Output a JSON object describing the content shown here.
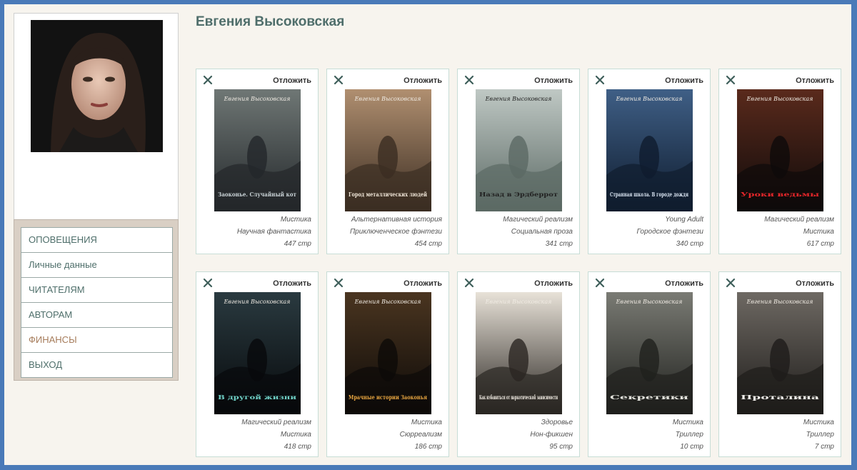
{
  "author_name": "Евгения Высоковская",
  "menu": [
    {
      "label": "ОПОВЕЩЕНИЯ"
    },
    {
      "label": "Личные данные"
    },
    {
      "label": "ЧИТАТЕЛЯМ"
    },
    {
      "label": "АВТОРАМ"
    },
    {
      "label": "ФИНАНСЫ"
    },
    {
      "label": "ВЫХОД"
    }
  ],
  "defer_label": "Отложить",
  "books": [
    {
      "author": "Евгения Высоковская",
      "title": "Заоконье. Случайный кот",
      "genre1": "Мистика",
      "genre2": "Научная фантастика",
      "pages": "447 стр",
      "bg1": "#6f7775",
      "bg2": "#23272a",
      "accent": "#c9d2d6"
    },
    {
      "author": "Евгения Высоковская",
      "title": "Город металлических людей",
      "genre1": "Альтернативная история",
      "genre2": "Приключенческое фэнтези",
      "pages": "454 стр",
      "bg1": "#b08f70",
      "bg2": "#3b2d22",
      "accent": "#f0e6d8"
    },
    {
      "author": "Евгения Высоковская",
      "title": "Назад в Эрдберрот",
      "genre1": "Магический реализм",
      "genre2": "Социальная проза",
      "pages": "341 стр",
      "bg1": "#bfc8c4",
      "bg2": "#5b6964",
      "accent": "#222"
    },
    {
      "author": "Евгения Высоковская",
      "title": "Странная школа. В городе дождя",
      "genre1": "Young Adult",
      "genre2": "Городское фэнтези",
      "pages": "340 стр",
      "bg1": "#3f5f86",
      "bg2": "#0f1c2e",
      "accent": "#d9e4f2"
    },
    {
      "author": "Евгения Высоковская",
      "title": "Уроки ведьмы",
      "genre1": "Магический реализм",
      "genre2": "Мистика",
      "pages": "617 стр",
      "bg1": "#5a2a1c",
      "bg2": "#0e0a0a",
      "accent": "#e6262a"
    },
    {
      "author": "Евгения Высоковская",
      "title": "В другой жизни",
      "genre1": "Магический реализм",
      "genre2": "Мистика",
      "pages": "418 стр",
      "bg1": "#2a3a40",
      "bg2": "#07090b",
      "accent": "#6fd0c6"
    },
    {
      "author": "Евгения Высоковская",
      "title": "Мрачные истории Заоконья",
      "genre1": "Мистика",
      "genre2": "Сюрреализм",
      "pages": "186 стр",
      "bg1": "#4a3520",
      "bg2": "#0d0a08",
      "accent": "#e8a640"
    },
    {
      "author": "Евгения Высоковская",
      "title": "Как избавиться от наркотической зависимости",
      "genre1": "Здоровье",
      "genre2": "Нон-фикшен",
      "pages": "95 стр",
      "bg1": "#e8e2d8",
      "bg2": "#2a2622",
      "accent": "#f4efe6"
    },
    {
      "author": "Евгения Высоковская",
      "title": "Секретики",
      "genre1": "Мистика",
      "genre2": "Триллер",
      "pages": "10 стр",
      "bg1": "#7a7b74",
      "bg2": "#1f201d",
      "accent": "#e3e3dc"
    },
    {
      "author": "Евгения Высоковская",
      "title": "Проталина",
      "genre1": "Мистика",
      "genre2": "Триллер",
      "pages": "7 стр",
      "bg1": "#6e6963",
      "bg2": "#1e1c1a",
      "accent": "#f2f0ec"
    }
  ]
}
